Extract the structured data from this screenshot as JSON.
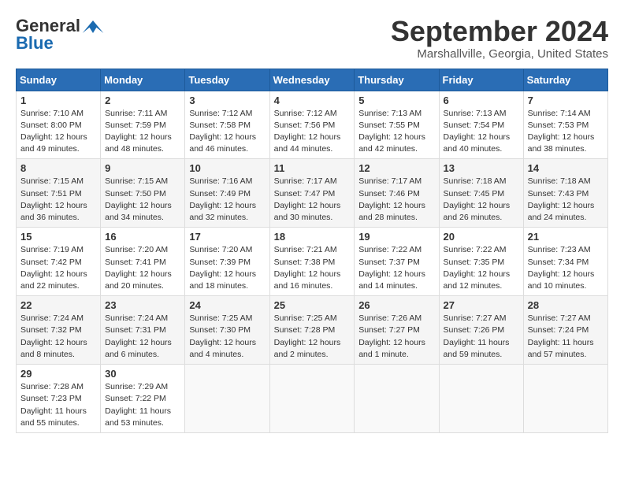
{
  "header": {
    "logo_general": "General",
    "logo_blue": "Blue",
    "month": "September 2024",
    "location": "Marshallville, Georgia, United States"
  },
  "weekdays": [
    "Sunday",
    "Monday",
    "Tuesday",
    "Wednesday",
    "Thursday",
    "Friday",
    "Saturday"
  ],
  "weeks": [
    [
      {
        "day": "1",
        "lines": [
          "Sunrise: 7:10 AM",
          "Sunset: 8:00 PM",
          "Daylight: 12 hours",
          "and 49 minutes."
        ]
      },
      {
        "day": "2",
        "lines": [
          "Sunrise: 7:11 AM",
          "Sunset: 7:59 PM",
          "Daylight: 12 hours",
          "and 48 minutes."
        ]
      },
      {
        "day": "3",
        "lines": [
          "Sunrise: 7:12 AM",
          "Sunset: 7:58 PM",
          "Daylight: 12 hours",
          "and 46 minutes."
        ]
      },
      {
        "day": "4",
        "lines": [
          "Sunrise: 7:12 AM",
          "Sunset: 7:56 PM",
          "Daylight: 12 hours",
          "and 44 minutes."
        ]
      },
      {
        "day": "5",
        "lines": [
          "Sunrise: 7:13 AM",
          "Sunset: 7:55 PM",
          "Daylight: 12 hours",
          "and 42 minutes."
        ]
      },
      {
        "day": "6",
        "lines": [
          "Sunrise: 7:13 AM",
          "Sunset: 7:54 PM",
          "Daylight: 12 hours",
          "and 40 minutes."
        ]
      },
      {
        "day": "7",
        "lines": [
          "Sunrise: 7:14 AM",
          "Sunset: 7:53 PM",
          "Daylight: 12 hours",
          "and 38 minutes."
        ]
      }
    ],
    [
      {
        "day": "8",
        "lines": [
          "Sunrise: 7:15 AM",
          "Sunset: 7:51 PM",
          "Daylight: 12 hours",
          "and 36 minutes."
        ]
      },
      {
        "day": "9",
        "lines": [
          "Sunrise: 7:15 AM",
          "Sunset: 7:50 PM",
          "Daylight: 12 hours",
          "and 34 minutes."
        ]
      },
      {
        "day": "10",
        "lines": [
          "Sunrise: 7:16 AM",
          "Sunset: 7:49 PM",
          "Daylight: 12 hours",
          "and 32 minutes."
        ]
      },
      {
        "day": "11",
        "lines": [
          "Sunrise: 7:17 AM",
          "Sunset: 7:47 PM",
          "Daylight: 12 hours",
          "and 30 minutes."
        ]
      },
      {
        "day": "12",
        "lines": [
          "Sunrise: 7:17 AM",
          "Sunset: 7:46 PM",
          "Daylight: 12 hours",
          "and 28 minutes."
        ]
      },
      {
        "day": "13",
        "lines": [
          "Sunrise: 7:18 AM",
          "Sunset: 7:45 PM",
          "Daylight: 12 hours",
          "and 26 minutes."
        ]
      },
      {
        "day": "14",
        "lines": [
          "Sunrise: 7:18 AM",
          "Sunset: 7:43 PM",
          "Daylight: 12 hours",
          "and 24 minutes."
        ]
      }
    ],
    [
      {
        "day": "15",
        "lines": [
          "Sunrise: 7:19 AM",
          "Sunset: 7:42 PM",
          "Daylight: 12 hours",
          "and 22 minutes."
        ]
      },
      {
        "day": "16",
        "lines": [
          "Sunrise: 7:20 AM",
          "Sunset: 7:41 PM",
          "Daylight: 12 hours",
          "and 20 minutes."
        ]
      },
      {
        "day": "17",
        "lines": [
          "Sunrise: 7:20 AM",
          "Sunset: 7:39 PM",
          "Daylight: 12 hours",
          "and 18 minutes."
        ]
      },
      {
        "day": "18",
        "lines": [
          "Sunrise: 7:21 AM",
          "Sunset: 7:38 PM",
          "Daylight: 12 hours",
          "and 16 minutes."
        ]
      },
      {
        "day": "19",
        "lines": [
          "Sunrise: 7:22 AM",
          "Sunset: 7:37 PM",
          "Daylight: 12 hours",
          "and 14 minutes."
        ]
      },
      {
        "day": "20",
        "lines": [
          "Sunrise: 7:22 AM",
          "Sunset: 7:35 PM",
          "Daylight: 12 hours",
          "and 12 minutes."
        ]
      },
      {
        "day": "21",
        "lines": [
          "Sunrise: 7:23 AM",
          "Sunset: 7:34 PM",
          "Daylight: 12 hours",
          "and 10 minutes."
        ]
      }
    ],
    [
      {
        "day": "22",
        "lines": [
          "Sunrise: 7:24 AM",
          "Sunset: 7:32 PM",
          "Daylight: 12 hours",
          "and 8 minutes."
        ]
      },
      {
        "day": "23",
        "lines": [
          "Sunrise: 7:24 AM",
          "Sunset: 7:31 PM",
          "Daylight: 12 hours",
          "and 6 minutes."
        ]
      },
      {
        "day": "24",
        "lines": [
          "Sunrise: 7:25 AM",
          "Sunset: 7:30 PM",
          "Daylight: 12 hours",
          "and 4 minutes."
        ]
      },
      {
        "day": "25",
        "lines": [
          "Sunrise: 7:25 AM",
          "Sunset: 7:28 PM",
          "Daylight: 12 hours",
          "and 2 minutes."
        ]
      },
      {
        "day": "26",
        "lines": [
          "Sunrise: 7:26 AM",
          "Sunset: 7:27 PM",
          "Daylight: 12 hours",
          "and 1 minute."
        ]
      },
      {
        "day": "27",
        "lines": [
          "Sunrise: 7:27 AM",
          "Sunset: 7:26 PM",
          "Daylight: 11 hours",
          "and 59 minutes."
        ]
      },
      {
        "day": "28",
        "lines": [
          "Sunrise: 7:27 AM",
          "Sunset: 7:24 PM",
          "Daylight: 11 hours",
          "and 57 minutes."
        ]
      }
    ],
    [
      {
        "day": "29",
        "lines": [
          "Sunrise: 7:28 AM",
          "Sunset: 7:23 PM",
          "Daylight: 11 hours",
          "and 55 minutes."
        ]
      },
      {
        "day": "30",
        "lines": [
          "Sunrise: 7:29 AM",
          "Sunset: 7:22 PM",
          "Daylight: 11 hours",
          "and 53 minutes."
        ]
      },
      {
        "day": "",
        "lines": []
      },
      {
        "day": "",
        "lines": []
      },
      {
        "day": "",
        "lines": []
      },
      {
        "day": "",
        "lines": []
      },
      {
        "day": "",
        "lines": []
      }
    ]
  ]
}
